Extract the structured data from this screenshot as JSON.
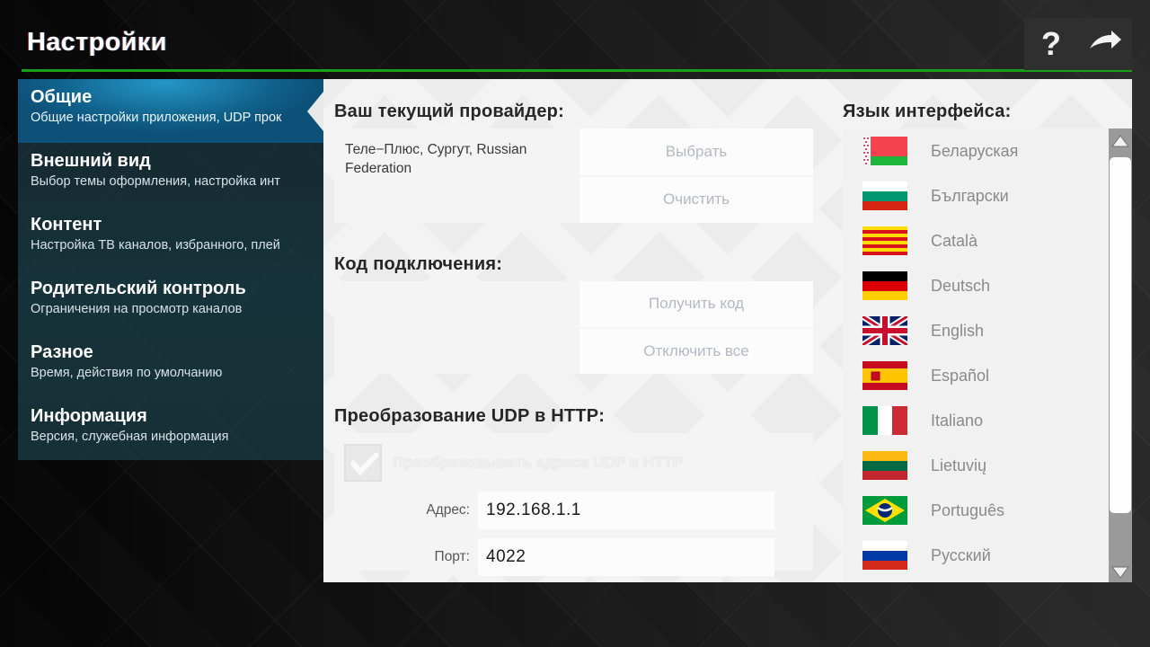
{
  "header": {
    "title": "Настройки",
    "accent_color": "#18a018",
    "buttons": [
      {
        "name": "help-button",
        "glyph": "?"
      },
      {
        "name": "exit-button",
        "glyph": "→"
      }
    ]
  },
  "sidebar": {
    "items": [
      {
        "title": "Общие",
        "subtitle": "Общие настройки приложения, UDP прок",
        "active": true
      },
      {
        "title": "Внешний вид",
        "subtitle": "Выбор темы оформления, настройка инт",
        "active": false
      },
      {
        "title": "Контент",
        "subtitle": "Настройка ТВ каналов, избранного, плей",
        "active": false
      },
      {
        "title": "Родительский контроль",
        "subtitle": "Ограничения на просмотр каналов",
        "active": false
      },
      {
        "title": "Разное",
        "subtitle": "Время, действия по умолчанию",
        "active": false
      },
      {
        "title": "Информация",
        "subtitle": "Версия, служебная информация",
        "active": false
      }
    ]
  },
  "main": {
    "provider": {
      "heading": "Ваш текущий провайдер:",
      "value": "Теле−Плюс, Сургут, Russian Federation",
      "select_button": "Выбрать",
      "clear_button": "Очистить"
    },
    "connection_code": {
      "heading": "Код подключения:",
      "get_code_button": "Получить код",
      "disable_all_button": "Отключить все"
    },
    "udp": {
      "heading": "Преобразование UDP в HTTP:",
      "checkbox_label": "Преобразовывать адреса UDP в HTTP",
      "checkbox_checked": true,
      "address_label": "Адрес:",
      "address_value": "192.168.1.1",
      "port_label": "Порт:",
      "port_value": "4022"
    },
    "language": {
      "heading": "Язык интерфейса:",
      "items": [
        {
          "name": "Беларуская",
          "flag": "by"
        },
        {
          "name": "Български",
          "flag": "bg"
        },
        {
          "name": "Català",
          "flag": "cat"
        },
        {
          "name": "Deutsch",
          "flag": "de"
        },
        {
          "name": "English",
          "flag": "gb"
        },
        {
          "name": "Español",
          "flag": "es"
        },
        {
          "name": "Italiano",
          "flag": "it"
        },
        {
          "name": "Lietuvių",
          "flag": "lt"
        },
        {
          "name": "Português",
          "flag": "br"
        },
        {
          "name": "Русский",
          "flag": "ru"
        }
      ],
      "scroll_up_glyph": "▲",
      "scroll_down_glyph": "▼"
    }
  }
}
